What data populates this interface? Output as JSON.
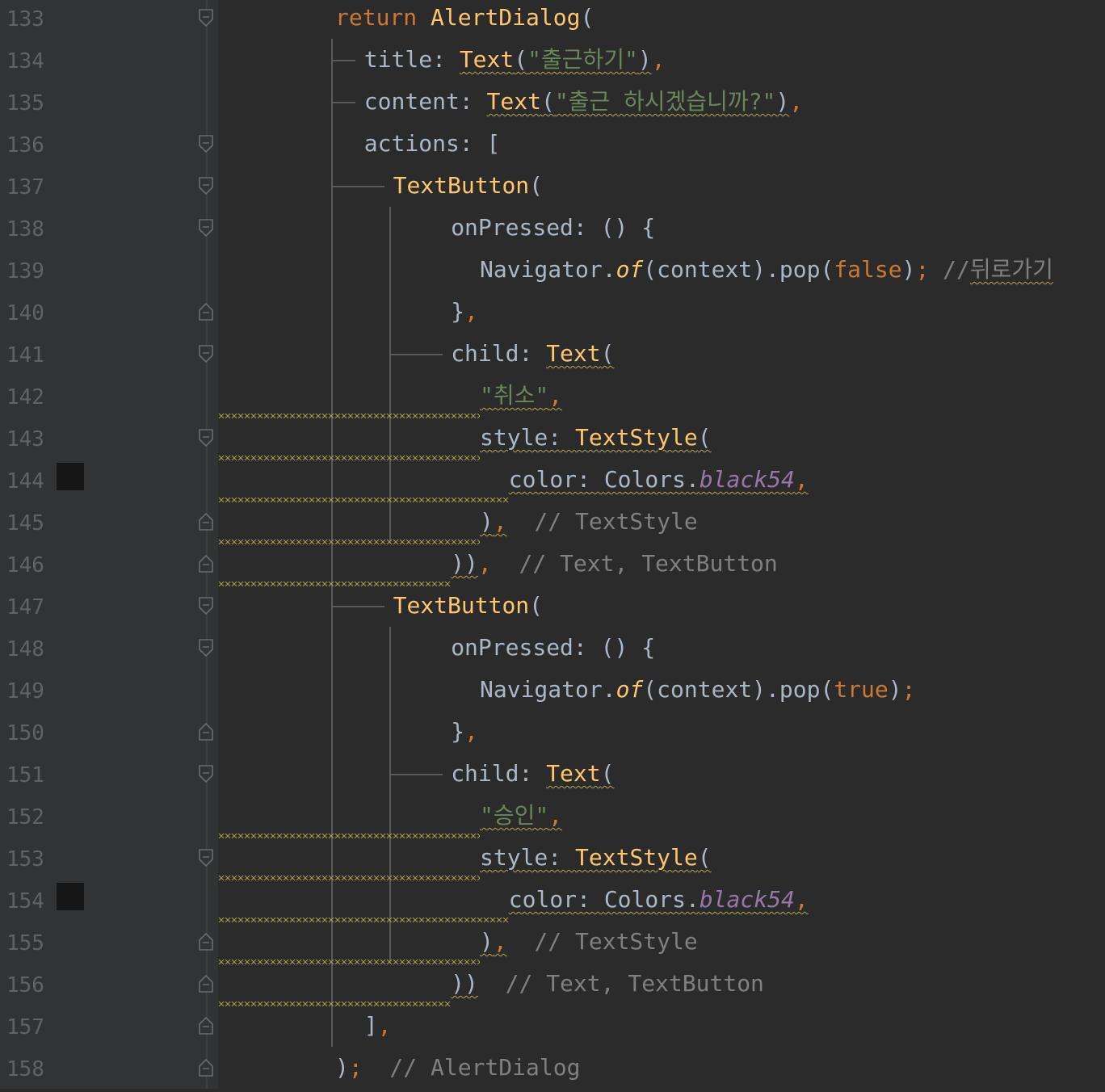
{
  "editor": {
    "line_numbers": [
      "133",
      "134",
      "135",
      "136",
      "137",
      "138",
      "139",
      "140",
      "141",
      "142",
      "143",
      "144",
      "145",
      "146",
      "147",
      "148",
      "149",
      "150",
      "151",
      "152",
      "153",
      "154",
      "155",
      "156",
      "157",
      "158"
    ],
    "lines": [
      {
        "tokens": [
          {
            "t": "return ",
            "c": "kw"
          },
          {
            "t": "AlertDialog",
            "c": "fn"
          },
          {
            "t": "(",
            "c": "plain"
          }
        ]
      },
      {
        "tokens": [
          {
            "t": "title: ",
            "c": "plain"
          },
          {
            "t": "Text",
            "c": "fn",
            "w": 1
          },
          {
            "t": "(",
            "c": "plain",
            "w": 1
          },
          {
            "t": "\"출근하기\"",
            "c": "str",
            "w": 1
          },
          {
            "t": ")",
            "c": "plain",
            "w": 1
          },
          {
            "t": ",",
            "c": "punct"
          }
        ]
      },
      {
        "tokens": [
          {
            "t": "content: ",
            "c": "plain"
          },
          {
            "t": "Text",
            "c": "fn",
            "w": 1
          },
          {
            "t": "(",
            "c": "plain",
            "w": 1
          },
          {
            "t": "\"출근 하시겠습니까?\"",
            "c": "str",
            "w": 1
          },
          {
            "t": ")",
            "c": "plain",
            "w": 1
          },
          {
            "t": ",",
            "c": "punct"
          }
        ]
      },
      {
        "tokens": [
          {
            "t": "actions: [",
            "c": "plain"
          }
        ]
      },
      {
        "tokens": [
          {
            "t": "TextButton",
            "c": "fn"
          },
          {
            "t": "(",
            "c": "plain"
          }
        ]
      },
      {
        "tokens": [
          {
            "t": "onPressed: () {",
            "c": "plain"
          }
        ]
      },
      {
        "tokens": [
          {
            "t": "Navigator.",
            "c": "plain"
          },
          {
            "t": "of",
            "c": "method"
          },
          {
            "t": "(context).pop(",
            "c": "plain"
          },
          {
            "t": "false",
            "c": "kw"
          },
          {
            "t": ")",
            "c": "plain"
          },
          {
            "t": ";",
            "c": "punct"
          },
          {
            "t": " //",
            "c": "comment"
          },
          {
            "t": "뒤로가기",
            "c": "comment",
            "w": 1
          }
        ]
      },
      {
        "tokens": [
          {
            "t": "}",
            "c": "plain"
          },
          {
            "t": ",",
            "c": "punct"
          }
        ]
      },
      {
        "tokens": [
          {
            "t": "child: ",
            "c": "plain"
          },
          {
            "t": "Text",
            "c": "fn",
            "w": 1
          },
          {
            "t": "(",
            "c": "plain",
            "w": 1
          }
        ]
      },
      {
        "tokens": [
          {
            "t": "\"취소\"",
            "c": "str",
            "w": 1
          },
          {
            "t": ",",
            "c": "punct",
            "w": 1
          }
        ]
      },
      {
        "tokens": [
          {
            "t": "style: ",
            "c": "plain",
            "w": 1
          },
          {
            "t": "TextStyle",
            "c": "fn",
            "w": 1
          },
          {
            "t": "(",
            "c": "plain",
            "w": 1
          }
        ]
      },
      {
        "tokens": [
          {
            "t": "color: ",
            "c": "plain",
            "w": 1
          },
          {
            "t": "Colors.",
            "c": "plain",
            "w": 1
          },
          {
            "t": "black54",
            "c": "const",
            "w": 1
          },
          {
            "t": ",",
            "c": "punct",
            "w": 1
          }
        ]
      },
      {
        "tokens": [
          {
            "t": ")",
            "c": "plain",
            "w": 1
          },
          {
            "t": ",",
            "c": "punct",
            "w": 1
          },
          {
            "t": "  // TextStyle",
            "c": "comment"
          }
        ]
      },
      {
        "tokens": [
          {
            "t": "))",
            "c": "plain",
            "w": 1
          },
          {
            "t": ",",
            "c": "punct"
          },
          {
            "t": "  // Text, TextButton",
            "c": "comment"
          }
        ]
      },
      {
        "tokens": [
          {
            "t": "TextButton",
            "c": "fn"
          },
          {
            "t": "(",
            "c": "plain"
          }
        ]
      },
      {
        "tokens": [
          {
            "t": "onPressed: () {",
            "c": "plain"
          }
        ]
      },
      {
        "tokens": [
          {
            "t": "Navigator.",
            "c": "plain"
          },
          {
            "t": "of",
            "c": "method"
          },
          {
            "t": "(context).pop(",
            "c": "plain"
          },
          {
            "t": "true",
            "c": "kw"
          },
          {
            "t": ")",
            "c": "plain"
          },
          {
            "t": ";",
            "c": "punct"
          }
        ]
      },
      {
        "tokens": [
          {
            "t": "}",
            "c": "plain"
          },
          {
            "t": ",",
            "c": "punct"
          }
        ]
      },
      {
        "tokens": [
          {
            "t": "child: ",
            "c": "plain"
          },
          {
            "t": "Text",
            "c": "fn",
            "w": 1
          },
          {
            "t": "(",
            "c": "plain",
            "w": 1
          }
        ]
      },
      {
        "tokens": [
          {
            "t": "\"승인\"",
            "c": "str",
            "w": 1
          },
          {
            "t": ",",
            "c": "punct",
            "w": 1
          }
        ]
      },
      {
        "tokens": [
          {
            "t": "style: ",
            "c": "plain",
            "w": 1
          },
          {
            "t": "TextStyle",
            "c": "fn",
            "w": 1
          },
          {
            "t": "(",
            "c": "plain",
            "w": 1
          }
        ]
      },
      {
        "tokens": [
          {
            "t": "color: ",
            "c": "plain",
            "w": 1
          },
          {
            "t": "Colors.",
            "c": "plain",
            "w": 1
          },
          {
            "t": "black54",
            "c": "const",
            "w": 1
          },
          {
            "t": ",",
            "c": "punct",
            "w": 1
          }
        ]
      },
      {
        "tokens": [
          {
            "t": ")",
            "c": "plain",
            "w": 1
          },
          {
            "t": ",",
            "c": "punct",
            "w": 1
          },
          {
            "t": "  // TextStyle",
            "c": "comment"
          }
        ]
      },
      {
        "tokens": [
          {
            "t": "))",
            "c": "plain",
            "w": 1
          },
          {
            "t": "  // Text, TextButton",
            "c": "comment"
          }
        ]
      },
      {
        "tokens": [
          {
            "t": "]",
            "c": "plain"
          },
          {
            "t": ",",
            "c": "punct"
          }
        ]
      },
      {
        "tokens": [
          {
            "t": ")",
            "c": "plain"
          },
          {
            "t": ";",
            "c": "punct"
          },
          {
            "t": "  // AlertDialog",
            "c": "comment"
          }
        ]
      }
    ],
    "breakpoint_lines": [
      "144",
      "154"
    ],
    "fold_start_lines": [
      "133",
      "136",
      "137",
      "138",
      "141",
      "143",
      "147",
      "148",
      "151",
      "153"
    ],
    "fold_end_lines": [
      "140",
      "145",
      "146",
      "150",
      "155",
      "156",
      "157",
      "158"
    ]
  },
  "theme": {
    "background": "#2b2b2b",
    "gutter": "#313335",
    "keyword": "#cc7832",
    "function": "#ffc66d",
    "string": "#6a8759",
    "comment": "#808080",
    "constant": "#9876aa",
    "text": "#a9b7c6"
  }
}
